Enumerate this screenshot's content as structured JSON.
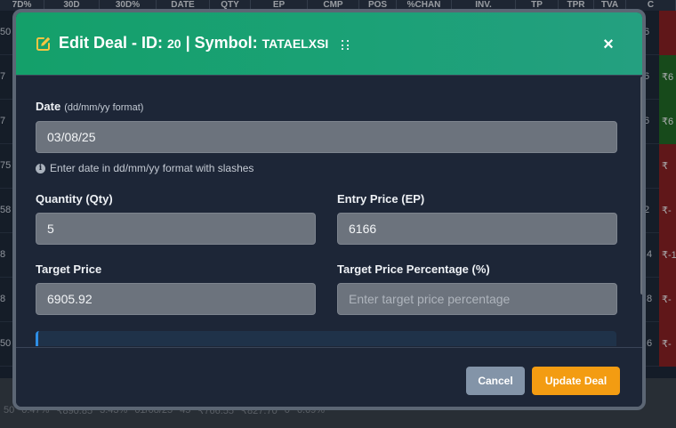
{
  "background": {
    "headers": [
      "7D%",
      "30D",
      "30D%",
      "DATE",
      "QTY",
      "EP",
      "CMP",
      "POS",
      "%CHAN",
      "INV.",
      "TP",
      "TPR",
      "TVA",
      "C"
    ],
    "rows": [
      {
        "left": "50",
        "right": "6",
        "pnl": "",
        "pnl_tone": "red"
      },
      {
        "left": "7",
        "right": "6",
        "pnl": "₹6",
        "pnl_tone": "green"
      },
      {
        "left": "7",
        "right": "6",
        "pnl": "₹6",
        "pnl_tone": "green"
      },
      {
        "left": "75",
        "right": "",
        "pnl": "₹",
        "pnl_tone": "red"
      },
      {
        "left": "58",
        "right": "2",
        "pnl": "₹-",
        "pnl_tone": "red"
      },
      {
        "left": "8",
        "right": ".4",
        "pnl": "₹-1",
        "pnl_tone": "red"
      },
      {
        "left": "8",
        "right": ".8",
        "pnl": "₹-",
        "pnl_tone": "red"
      },
      {
        "left": "50",
        "right": ".6",
        "pnl": "₹-",
        "pnl_tone": "red"
      }
    ],
    "bottom_row": [
      "50",
      "0.47%",
      "₹890.85",
      "3.43%",
      "01/08/25",
      "45",
      "₹766.55",
      "₹827.70",
      "0",
      "6.69%"
    ]
  },
  "modal": {
    "title_prefix": "Edit Deal - ID: ",
    "deal_id": "20",
    "title_mid": " | Symbol: ",
    "symbol": "TATAELXSI",
    "close_label": "×",
    "fields": {
      "date": {
        "label": "Date",
        "hint": "(dd/mm/yy format)",
        "value": "03/08/25",
        "help": "Enter date in dd/mm/yy format with slashes"
      },
      "quantity": {
        "label": "Quantity (Qty)",
        "value": "5"
      },
      "entry_price": {
        "label": "Entry Price (EP)",
        "value": "6166"
      },
      "target_price": {
        "label": "Target Price",
        "value": "6905.92"
      },
      "target_percentage": {
        "label": "Target Price Percentage (%)",
        "value": "",
        "placeholder": "Enter target price percentage"
      }
    },
    "buttons": {
      "cancel": "Cancel",
      "update": "Update Deal"
    }
  },
  "colors": {
    "header_green": "#1ba176",
    "update_orange": "#f39c12",
    "cancel_gray": "#8394a8",
    "pnl_red": "#8f1d1d",
    "pnl_green": "#1f6b1f"
  }
}
